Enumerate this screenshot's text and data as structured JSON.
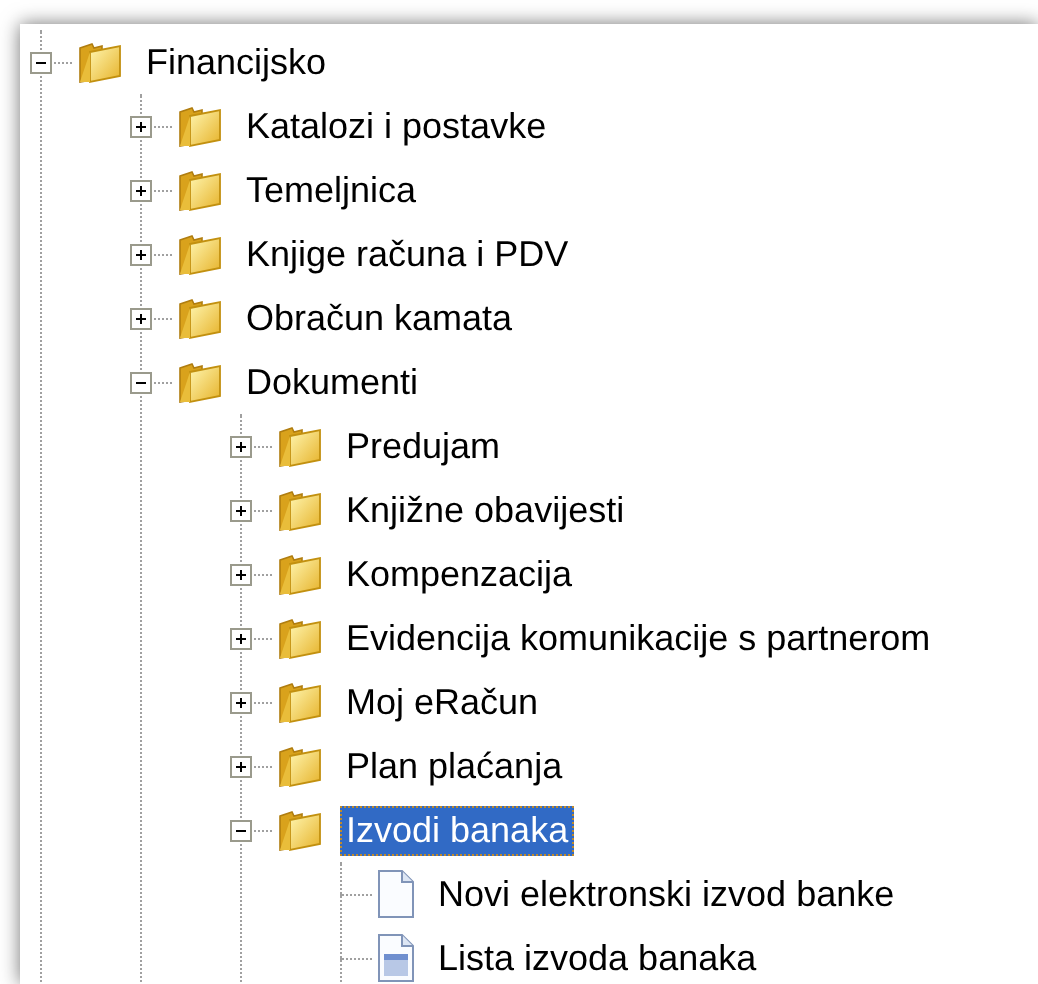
{
  "tree": [
    {
      "label": "Financijsko",
      "kind": "folder",
      "expanded": true,
      "selected": false,
      "children": [
        {
          "label": "Katalozi i postavke",
          "kind": "folder",
          "expanded": false,
          "selected": false
        },
        {
          "label": "Temeljnica",
          "kind": "folder",
          "expanded": false,
          "selected": false
        },
        {
          "label": "Knjige računa i PDV",
          "kind": "folder",
          "expanded": false,
          "selected": false
        },
        {
          "label": "Obračun kamata",
          "kind": "folder",
          "expanded": false,
          "selected": false
        },
        {
          "label": "Dokumenti",
          "kind": "folder",
          "expanded": true,
          "selected": false,
          "children": [
            {
              "label": "Predujam",
              "kind": "folder",
              "expanded": false,
              "selected": false
            },
            {
              "label": "Knjižne obavijesti",
              "kind": "folder",
              "expanded": false,
              "selected": false
            },
            {
              "label": "Kompenzacija",
              "kind": "folder",
              "expanded": false,
              "selected": false
            },
            {
              "label": "Evidencija komunikacije s partnerom",
              "kind": "folder",
              "expanded": false,
              "selected": false
            },
            {
              "label": "Moj eRačun",
              "kind": "folder",
              "expanded": false,
              "selected": false
            },
            {
              "label": "Plan plaćanja",
              "kind": "folder",
              "expanded": false,
              "selected": false
            },
            {
              "label": "Izvodi banaka",
              "kind": "folder",
              "expanded": true,
              "selected": true,
              "children": [
                {
                  "label": "Novi elektronski izvod banke",
                  "kind": "document",
                  "selected": false
                },
                {
                  "label": "Lista izvoda banaka",
                  "kind": "list",
                  "selected": false
                }
              ]
            }
          ]
        }
      ]
    }
  ]
}
